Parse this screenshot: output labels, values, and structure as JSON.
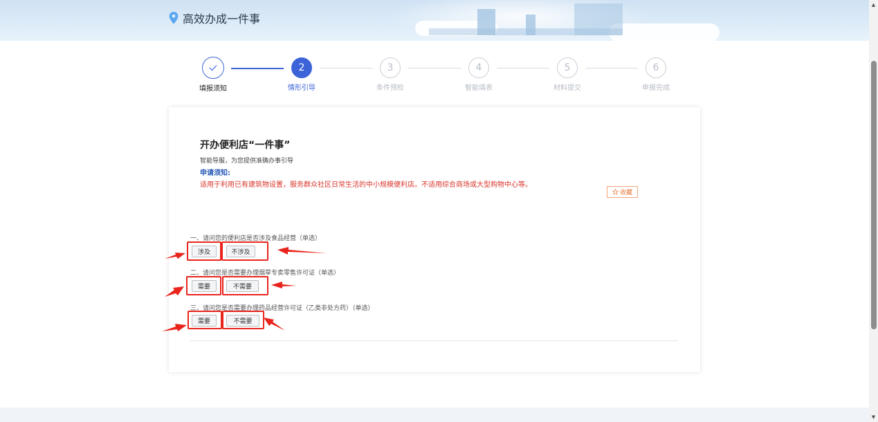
{
  "header": {
    "title": "高效办成一件事",
    "pin_icon": "location-pin-icon"
  },
  "steps": [
    {
      "number": "✓",
      "label": "填报须知",
      "state": "done"
    },
    {
      "number": "2",
      "label": "情形引导",
      "state": "active"
    },
    {
      "number": "3",
      "label": "条件预检",
      "state": "pending"
    },
    {
      "number": "4",
      "label": "智能填表",
      "state": "pending"
    },
    {
      "number": "5",
      "label": "材料提交",
      "state": "pending"
    },
    {
      "number": "6",
      "label": "申报完成",
      "state": "pending"
    }
  ],
  "card": {
    "title": "开办便利店“一件事”",
    "subtitle": "智能导服，为您提供准确办事引导",
    "notice_heading": "申请须知:",
    "notice_text": "适用于利用已有建筑物设置，服务群众社区日常生活的中小规模便利店。不适用综合商场或大型购物中心等。",
    "favorite_label": "收藏",
    "favorite_icon": "star-icon"
  },
  "questions": [
    {
      "text": "一、请问您的便利店是否涉及食品经营（单选）",
      "options": [
        "涉及",
        "不涉及"
      ]
    },
    {
      "text": "二、请问您是否需要办理烟草专卖零售许可证（单选）",
      "options": [
        "需要",
        "不需要"
      ]
    },
    {
      "text": "三、请问您是否需要办理药品经营许可证（乙类非处方药）（单选）",
      "options": [
        "需要",
        "不需要"
      ]
    }
  ],
  "colors": {
    "primary": "#3c64d8",
    "notice_red": "#d9352b",
    "notice_heading": "#2557b8",
    "highlight_red": "#e8241c",
    "favorite_orange": "#e8793e"
  }
}
